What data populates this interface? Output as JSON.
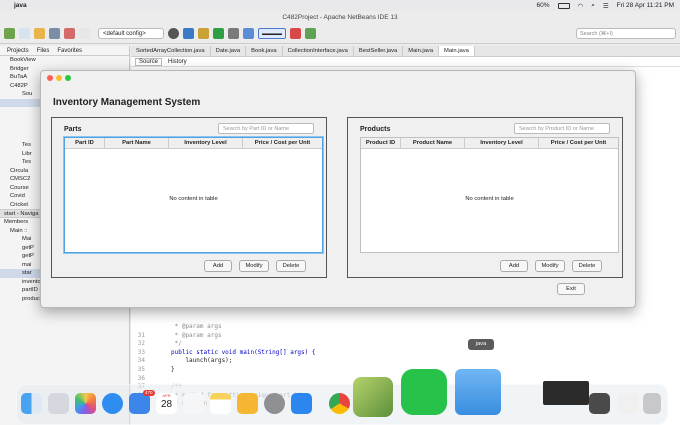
{
  "menubar": {
    "app_name": "java",
    "battery": "60%",
    "datetime": "Fri 28 Apr  11:21 PM"
  },
  "ide": {
    "window_title": "C482Project - Apache NetBeans IDE 13",
    "config": "<default config>",
    "search_placeholder": "Search (⌘+I)",
    "left_tabs": [
      "Projects",
      "Files",
      "Favorites"
    ],
    "tree": [
      "BookView",
      "Bridger",
      "BuTaA",
      "C482P",
      "Sou",
      "",
      "",
      "",
      "",
      "",
      "Tes",
      "Libr",
      "Tes",
      "Circula",
      "CMSC2",
      "Course",
      "Covid",
      "Cricket"
    ],
    "navigator_title": "start - Naviga",
    "members_label": "Members",
    "members": [
      "Main :: ",
      "Mai",
      "getP",
      "getP",
      "mai",
      "star"
    ],
    "fields": [
      "inventory : Inventory",
      "partID : int",
      "productID : int"
    ],
    "editor_tabs": [
      "SortedArrayCollection.java",
      "Date.java",
      "Book.java",
      "CollectionInterface.java",
      "BestSeller.java",
      "Main.java",
      "Main.java"
    ],
    "editor_sub": [
      "Source",
      "History"
    ],
    "code": [
      {
        "ln": "",
        "text": " * @param args"
      },
      {
        "ln": "31",
        "text": " * @param args"
      },
      {
        "ln": "32",
        "text": " */"
      },
      {
        "ln": "33",
        "text": "public static void main(String[] args) {"
      },
      {
        "ln": "34",
        "text": "    launch(args);"
      },
      {
        "ln": "35",
        "text": "}"
      },
      {
        "ln": "36",
        "text": ""
      },
      {
        "ln": "37",
        "text": "/**"
      },
      {
        "ln": "38",
        "text": " * method for getting unique part id."
      },
      {
        "ln": "39",
        "text": " * @return"
      }
    ]
  },
  "app": {
    "title": "Inventory Management System",
    "parts": {
      "title": "Parts",
      "search_placeholder": "Search by Part ID or Name",
      "columns": [
        "Part ID",
        "Part Name",
        "Inventory Level",
        "Price / Cost per Unit"
      ],
      "empty": "No content in table",
      "buttons": [
        "Add",
        "Modify",
        "Delete"
      ]
    },
    "products": {
      "title": "Products",
      "search_placeholder": "Search by Product ID or Name",
      "columns": [
        "Product ID",
        "Product Name",
        "Inventory Level",
        "Price / Cost per Unit"
      ],
      "empty": "No content in table",
      "buttons": [
        "Add",
        "Modify",
        "Delete"
      ]
    },
    "exit_label": "Exit",
    "traffic_colors": [
      "#ff5f57",
      "#febc2e",
      "#28c840"
    ]
  },
  "dock": {
    "tooltip": "java",
    "calendar_month": "APR",
    "calendar_day": "28",
    "mail_badge": "470"
  }
}
